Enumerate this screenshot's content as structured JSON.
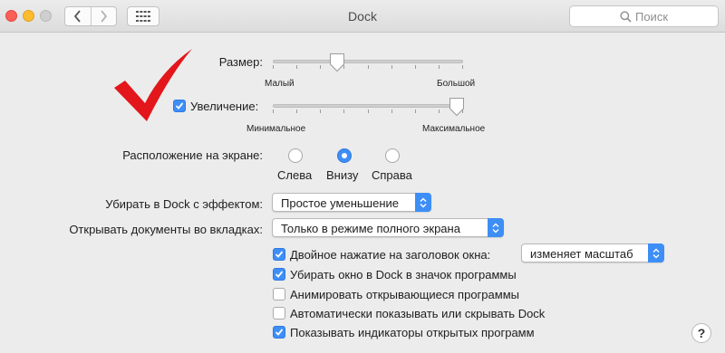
{
  "window": {
    "title": "Dock",
    "search_placeholder": "Поиск",
    "help_label": "?"
  },
  "colors": {
    "accent": "#3e8ef7",
    "annotation_check": "#e3161c",
    "window_bg": "#ececec"
  },
  "size": {
    "label": "Размер:",
    "min_label": "Малый",
    "max_label": "Большой",
    "value_fraction": 0.33
  },
  "magnification": {
    "label": "Увеличение:",
    "checked": true,
    "min_label": "Минимальное",
    "max_label": "Максимальное",
    "value_fraction": 0.96
  },
  "position": {
    "label": "Расположение на экране:",
    "options": [
      "Слева",
      "Внизу",
      "Справа"
    ],
    "selected": "Внизу"
  },
  "minimize_effect": {
    "label": "Убирать в Dock с эффектом:",
    "value": "Простое уменьшение"
  },
  "open_in_tabs": {
    "label": "Открывать документы во вкладках:",
    "value": "Только в режиме полного экрана"
  },
  "double_click": {
    "label": "Двойное нажатие на заголовок окна:",
    "checked": true,
    "value": "изменяет масштаб"
  },
  "checkboxes": [
    {
      "label": "Убирать окно в Dock в значок программы",
      "checked": true
    },
    {
      "label": "Анимировать открывающиеся программы",
      "checked": false
    },
    {
      "label": "Автоматически показывать или скрывать Dock",
      "checked": false
    },
    {
      "label": "Показывать индикаторы открытых программ",
      "checked": true
    }
  ],
  "icons": {
    "back": "chevron-left-icon",
    "forward": "chevron-right-icon",
    "show_all": "grid-icon",
    "search": "magnifier-icon",
    "annotation": "red-checkmark-icon"
  }
}
